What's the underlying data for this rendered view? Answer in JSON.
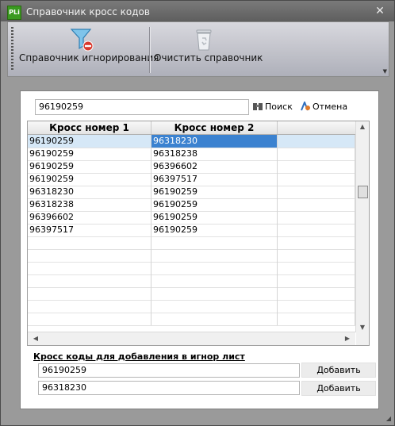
{
  "window": {
    "title": "Справочник кросс кодов",
    "app_badge": "PLi"
  },
  "ribbon": {
    "ignore_ref_label": "Справочник игнорирования",
    "clear_ref_label": "Очистить справочник",
    "ignore_ref_icon": "filter-remove-icon",
    "clear_ref_icon": "recycle-bin-icon"
  },
  "search": {
    "value": "96190259",
    "search_label": "Поиск",
    "cancel_label": "Отмена"
  },
  "grid": {
    "headers": [
      "Кросс номер 1",
      "Кросс номер 2"
    ],
    "rows": [
      [
        "96190259",
        "96318230"
      ],
      [
        "96190259",
        "96318238"
      ],
      [
        "96190259",
        "96396602"
      ],
      [
        "96190259",
        "96397517"
      ],
      [
        "96318230",
        "96190259"
      ],
      [
        "96318238",
        "96190259"
      ],
      [
        "96396602",
        "96190259"
      ],
      [
        "96397517",
        "96190259"
      ]
    ],
    "selected_row": 0
  },
  "add_section": {
    "label": "Кросс коды для добавления в игнор лист",
    "field1": "96190259",
    "field2": "96318230",
    "add_label": "Добавить"
  }
}
